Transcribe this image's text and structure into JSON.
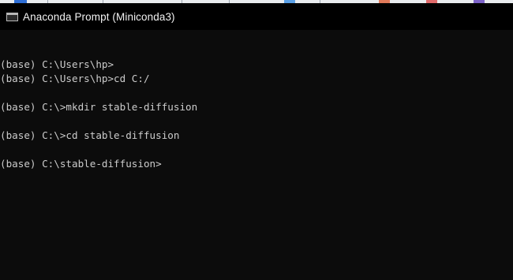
{
  "window": {
    "title": "Anaconda Prompt (Miniconda3)",
    "icon": "terminal-window-icon"
  },
  "colors": {
    "console_background": "#0c0c0c",
    "console_text": "#cccccc",
    "titlebar_background": "#000000",
    "titlebar_text": "#f2f2f2"
  },
  "console": {
    "lines": [
      "",
      "(base) C:\\Users\\hp>",
      "(base) C:\\Users\\hp>cd C:/",
      "",
      "(base) C:\\>mkdir stable-diffusion",
      "",
      "(base) C:\\>cd stable-diffusion",
      "",
      "(base) C:\\stable-diffusion>"
    ]
  }
}
